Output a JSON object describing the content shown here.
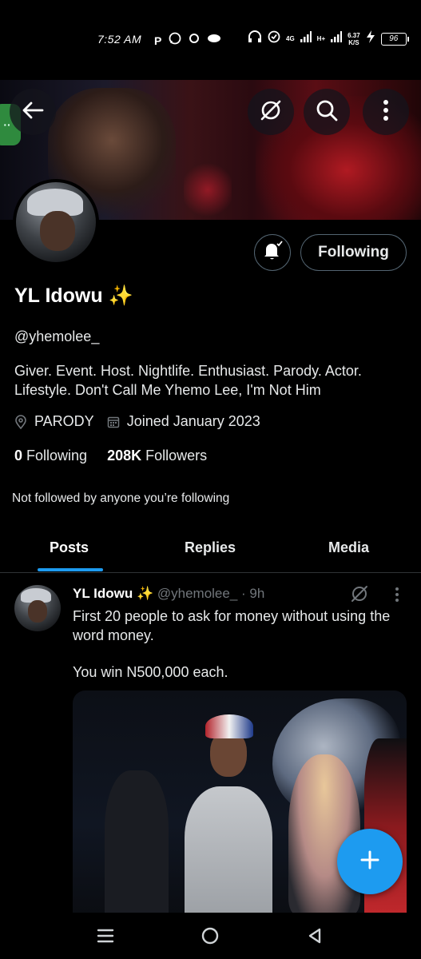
{
  "status_bar": {
    "time": "7:52 AM",
    "network": "4G",
    "network2": "H+",
    "speed_value": "6.37",
    "speed_unit": "K/S",
    "battery": "96"
  },
  "profile": {
    "name": "YL Idowu ✨",
    "handle": "@yhemolee_",
    "bio": "Giver. Event. Host. Nightlife. Enthusiast. Parody. Actor. Lifestyle. Don't Call Me Yhemo Lee, I'm Not Him",
    "location": "PARODY",
    "joined": "Joined January 2023",
    "following_count": "0",
    "following_label": "Following",
    "followers_count": "208K",
    "followers_label": "Followers",
    "not_followed_text": "Not followed by anyone you’re following",
    "follow_button_label": "Following"
  },
  "tabs": [
    {
      "label": "Posts",
      "active": true
    },
    {
      "label": "Replies",
      "active": false
    },
    {
      "label": "Media",
      "active": false
    }
  ],
  "post": {
    "author_name": "YL Idowu ✨",
    "author_handle": "@yhemolee_",
    "time": "· 9h",
    "text": "First 20 people to ask for money without using the word money.",
    "text2": "You win N500,000 each."
  },
  "colors": {
    "accent": "#1d9bf0",
    "background": "#000000",
    "border": "#2f3336",
    "muted": "#71767b"
  },
  "icons": {
    "back": "arrow-left-icon",
    "grok": "grok-icon",
    "search": "search-icon",
    "more": "more-vertical-icon",
    "bell": "bell-icon",
    "location": "location-pin-icon",
    "calendar": "calendar-icon",
    "compose": "plus-icon"
  }
}
